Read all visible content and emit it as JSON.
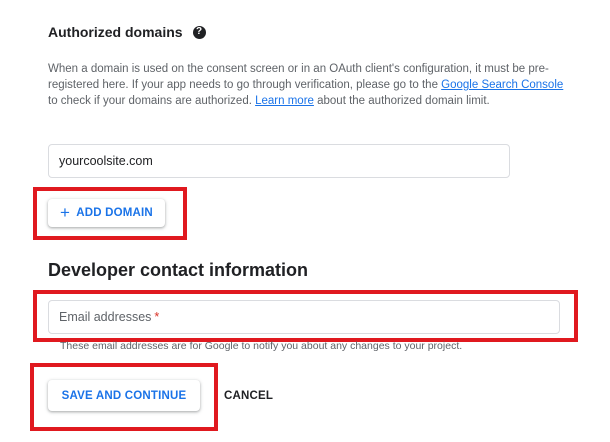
{
  "authorized_domains": {
    "title": "Authorized domains",
    "help_glyph": "?",
    "description": {
      "part1": "When a domain is used on the consent screen or in an OAuth client's configuration, it must be pre-registered here. If your app needs to go through verification, please go to the ",
      "link1": "Google Search Console",
      "part2": " to check if your domains are authorized. ",
      "link2": "Learn more",
      "part3": " about the authorized domain limit."
    },
    "domain_value": "yourcoolsite.com",
    "add_button": {
      "icon": "+",
      "label": "ADD DOMAIN"
    }
  },
  "developer_contact": {
    "title": "Developer contact information",
    "email_placeholder": "Email addresses",
    "required_mark": "*",
    "hint": "These email addresses are for Google to notify you about any changes to your project."
  },
  "actions": {
    "save_label": "SAVE AND CONTINUE",
    "cancel_label": "CANCEL"
  },
  "colors": {
    "accent": "#1a73e8",
    "highlight_box": "#e0191f",
    "required": "#d93025"
  }
}
